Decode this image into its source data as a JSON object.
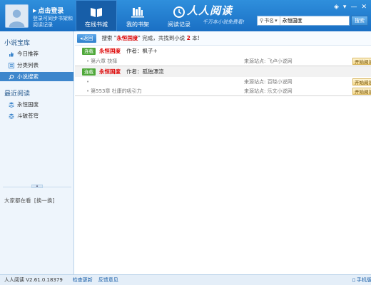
{
  "header": {
    "login_title": "点击登录",
    "login_hint": "登录可同步书架和阅读记录",
    "tabs": [
      {
        "label": "在线书城",
        "icon": "book-icon",
        "active": true
      },
      {
        "label": "我的书架",
        "icon": "bookshelf-icon",
        "active": false
      },
      {
        "label": "阅读记录",
        "icon": "clock-icon",
        "active": false
      }
    ],
    "brand_name": "人人阅读",
    "brand_slogan": "千万本小说免费看!"
  },
  "search": {
    "category": "书名",
    "value": "永恒国度",
    "button": "搜索"
  },
  "sidebar": {
    "section1": "小说宝库",
    "items": [
      {
        "label": "今日推荐",
        "icon": "thumbs-up-icon",
        "active": false
      },
      {
        "label": "分类列表",
        "icon": "list-icon",
        "active": false
      },
      {
        "label": "小说搜索",
        "icon": "search-icon",
        "active": true
      }
    ],
    "section2": "最近阅读",
    "recent": [
      {
        "label": "永恒国度",
        "icon": "book-stack-icon"
      },
      {
        "label": "斗破苍穹",
        "icon": "book-stack-icon"
      }
    ],
    "footer_text": "大家都在看",
    "footer_link": "[换一换]"
  },
  "main": {
    "back_label": "返回",
    "result_prefix": "搜索 \"",
    "result_keyword": "永恒国度",
    "result_middle": "\" 完成，共找到小说",
    "result_count": "2",
    "result_suffix": "本!",
    "books": [
      {
        "badge": "连载",
        "title": "永恒国度",
        "author": "作者：枫子+",
        "rows": [
          {
            "chapter": "第六章 抉择",
            "source": "来源站点: 飞卢小说网",
            "button": "开始阅读"
          }
        ]
      },
      {
        "badge": "连载",
        "title": "永恒国度",
        "author": "作者：孤独漂流",
        "rows": [
          {
            "chapter": "",
            "source": "来源站点: 百晓小说网",
            "button": "开始阅读"
          },
          {
            "chapter": "第553章 杜康的吸引力",
            "source": "来源站点: 乐文小说网",
            "button": "开始阅读"
          }
        ]
      }
    ]
  },
  "statusbar": {
    "version": "人人阅读 V2.61.0.18379",
    "update": "检查更新",
    "feedback": "反馈意见",
    "phone": "手机版"
  }
}
